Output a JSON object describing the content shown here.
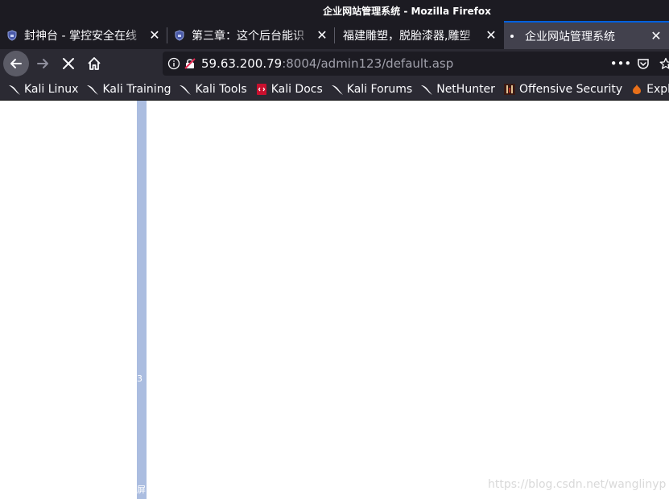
{
  "window": {
    "title": "企业网站管理系统 - Mozilla Firefox"
  },
  "tabs": [
    {
      "title": "封神台 - 掌控安全在线",
      "favicon": "shield-icon",
      "active": false
    },
    {
      "title": "第三章：这个后台能识",
      "favicon": "shield-icon",
      "active": false
    },
    {
      "title": "福建雕塑，脱胎漆器,雕塑",
      "favicon": "",
      "active": false
    },
    {
      "title": "企业网站管理系统",
      "favicon": "loading-dot",
      "active": true
    }
  ],
  "urlbar": {
    "host": "59.63.200.79",
    "rest": ":8004/admin123/default.asp"
  },
  "bookmarks": [
    {
      "label": "Kali Linux",
      "icon": "kali-dragon-icon"
    },
    {
      "label": "Kali Training",
      "icon": "kali-dragon-icon"
    },
    {
      "label": "Kali Tools",
      "icon": "kali-dragon-icon"
    },
    {
      "label": "Kali Docs",
      "icon": "kali-docs-icon"
    },
    {
      "label": "Kali Forums",
      "icon": "kali-dragon-icon"
    },
    {
      "label": "NetHunter",
      "icon": "kali-dragon-icon"
    },
    {
      "label": "Offensive Security",
      "icon": "offsec-icon"
    },
    {
      "label": "Exploit-DB",
      "icon": "exploitdb-icon"
    }
  ],
  "content": {
    "strip_number": "3",
    "strip_char": "屏"
  },
  "watermark": "https://blog.csdn.net/wanglinyp",
  "colors": {
    "chrome_dark": "#1c1b22",
    "toolbar": "#2b2a33",
    "active_tab": "#42414d",
    "strip": "#abbde0"
  }
}
